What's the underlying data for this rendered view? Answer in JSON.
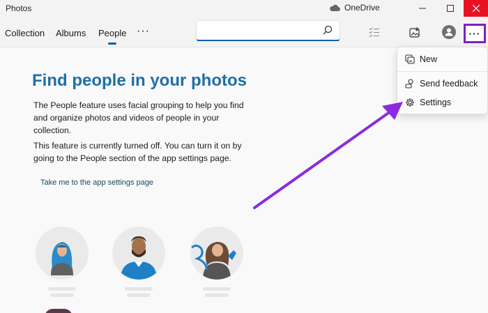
{
  "window": {
    "title": "Photos",
    "onedrive_label": "OneDrive",
    "minimize": "—",
    "maximize": "☐",
    "close": "✕"
  },
  "nav": {
    "tabs": [
      {
        "label": "Collection"
      },
      {
        "label": "Albums"
      },
      {
        "label": "People",
        "active": true
      }
    ],
    "more": "···"
  },
  "search": {
    "placeholder": "",
    "value": ""
  },
  "toolbar": {
    "more_label": "···"
  },
  "main": {
    "heading": "Find people in your photos",
    "paragraph1": "The People feature uses facial grouping to help you find and organize photos and videos of people in your collection.",
    "paragraph2": "This feature is currently turned off. You can turn it on by going to the People section of the app settings page.",
    "link": "Take me to the app settings page"
  },
  "menu": {
    "items": [
      {
        "label": "New",
        "icon": "new-icon"
      },
      {
        "label": "Send feedback",
        "icon": "feedback-icon"
      },
      {
        "label": "Settings",
        "icon": "gear-icon"
      }
    ]
  },
  "colors": {
    "accent": "#005fb8",
    "heading": "#1f6fa8",
    "highlight_box": "#7b21c2",
    "arrow": "#8a2be2",
    "close_button": "#e81123"
  }
}
